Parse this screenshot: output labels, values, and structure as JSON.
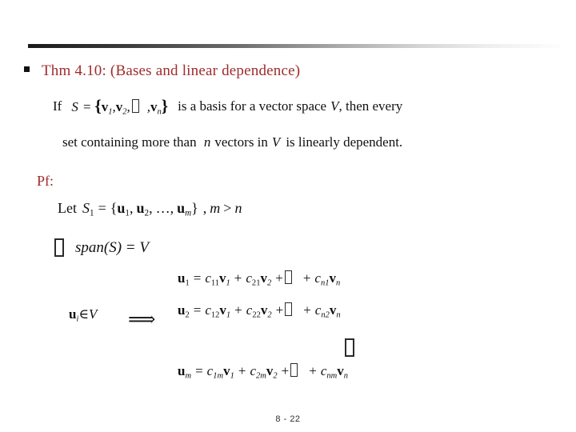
{
  "slide": {
    "page_number": "8 - 22",
    "accent_color": "#A02C2C",
    "text_color": "#101010",
    "rule_color_start": "#1a1a1a",
    "rule_color_end": "#fdfdfd",
    "background": "#ffffff"
  },
  "theorem": {
    "heading": "Thm 4.10: (Bases and linear dependence)",
    "line1_pre": "If",
    "line1_math": {
      "s": "S",
      "eq": "=",
      "open_brace": "{",
      "v1": "v",
      "v1_sub": "1",
      "comma1": ",",
      "v2": "v",
      "v2_sub": "2",
      "comma2": ",",
      "ellipsis_glyph": "missing-glyph-box",
      "comma3": ",",
      "vn": "v",
      "vn_sub": "n",
      "close_brace": "}"
    },
    "line1_post_a": "is a basis for a vector space",
    "line1_post_v": "V",
    "line1_post_b": ", then every",
    "line2_a": "set containing more than",
    "line2_n": "n",
    "line2_b": "vectors in",
    "line2_v": "V",
    "line2_c": "is linearly dependent."
  },
  "proof": {
    "label": "Pf:",
    "let_line": {
      "let": "Let",
      "s1": "S",
      "s1_sub": "1",
      "eq": "=",
      "open": "{",
      "u1": "u",
      "u1_sub": "1",
      "c1": ",",
      "u2": "u",
      "u2_sub": "2",
      "c2": ",",
      "dots": "…",
      "c3": ",",
      "um": "u",
      "um_sub": "m",
      "close": "}",
      "comma": ",",
      "m": "m",
      "gt": ">",
      "n": "n"
    },
    "span_line": {
      "implies_glyph": "missing-glyph-box",
      "expr": "span(S) = V"
    },
    "membership": {
      "u": "u",
      "u_sub": "i",
      "in": "∈",
      "v": "V"
    },
    "implication_arrow": "⟹",
    "equations": [
      {
        "lhs": "u",
        "lhs_sub": "1",
        "eq": "=",
        "t1_c": "c",
        "t1_c_sub": "11",
        "t1_v": "v",
        "t1_v_sub": "1",
        "plus1": "+",
        "t2_c": "c",
        "t2_c_sub": "21",
        "t2_v": "v",
        "t2_v_sub": "2",
        "plus2": "+",
        "ellipsis_glyph": "missing-glyph-box",
        "plus3": "+",
        "t3_c": "c",
        "t3_c_sub": "n1",
        "t3_v": "v",
        "t3_v_sub": "n"
      },
      {
        "lhs": "u",
        "lhs_sub": "2",
        "eq": "=",
        "t1_c": "c",
        "t1_c_sub": "12",
        "t1_v": "v",
        "t1_v_sub": "1",
        "plus1": "+",
        "t2_c": "c",
        "t2_c_sub": "22",
        "t2_v": "v",
        "t2_v_sub": "2",
        "plus2": "+",
        "ellipsis_glyph": "missing-glyph-box",
        "plus3": "+",
        "t3_c": "c",
        "t3_c_sub": "n2",
        "t3_v": "v",
        "t3_v_sub": "n"
      },
      {
        "lhs": "u",
        "lhs_sub": "m",
        "eq": "=",
        "t1_c": "c",
        "t1_c_sub": "1m",
        "t1_v": "v",
        "t1_v_sub": "1",
        "plus1": "+",
        "t2_c": "c",
        "t2_c_sub": "2m",
        "t2_v": "v",
        "t2_v_sub": "2",
        "plus2": "+",
        "ellipsis_glyph": "missing-glyph-box",
        "plus3": "+",
        "t3_c": "c",
        "t3_c_sub": "nm",
        "t3_v": "v",
        "t3_v_sub": "n"
      }
    ],
    "vertical_dots_glyph": "missing-glyph-box"
  }
}
